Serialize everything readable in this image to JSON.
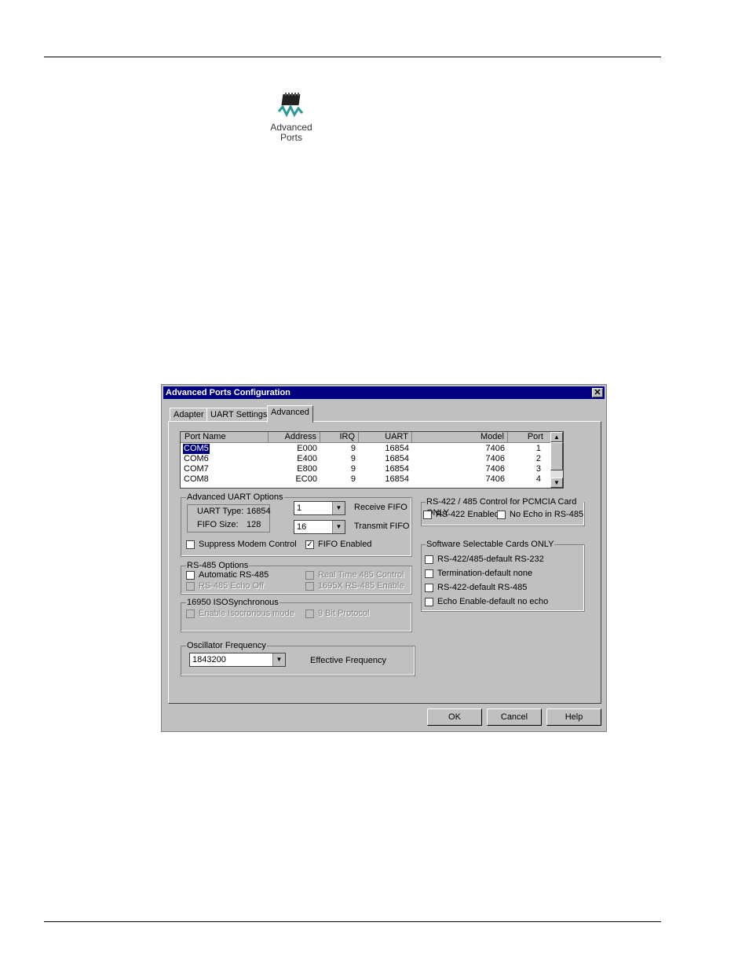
{
  "icon": {
    "name": "chip-icon",
    "label_line1": "Advanced",
    "label_line2": "Ports"
  },
  "dialog": {
    "title": "Advanced Ports Configuration",
    "close": "✕",
    "tabs": [
      "Adapter",
      "UART Settings",
      "Advanced"
    ],
    "active_tab": "Advanced",
    "list": {
      "columns": [
        "Port Name",
        "Address",
        "IRQ",
        "UART",
        "Model",
        "Port"
      ],
      "rows": [
        [
          "COM5",
          "E000",
          "9",
          "16854",
          "7406",
          "1"
        ],
        [
          "COM6",
          "E400",
          "9",
          "16854",
          "7406",
          "2"
        ],
        [
          "COM7",
          "E800",
          "9",
          "16854",
          "7406",
          "3"
        ],
        [
          "COM8",
          "EC00",
          "9",
          "16854",
          "7406",
          "4"
        ]
      ],
      "selected": "COM5"
    },
    "advanced_uart": {
      "title": "Advanced UART Options",
      "uart_type_label": "UART Type:",
      "uart_type_value": "16854",
      "fifo_size_label": "FIFO Size:",
      "fifo_size_value": "128",
      "receive_fifo_value": "1",
      "receive_fifo_label": "Receive FIFO",
      "transmit_fifo_value": "16",
      "transmit_fifo_label": "Transmit FIFO",
      "suppress_modem_label": "Suppress Modem Control",
      "fifo_enabled_label": "FIFO Enabled",
      "fifo_enabled_check": "✓"
    },
    "rs485": {
      "title": "RS-485 Options",
      "automatic_label": "Automatic RS-485",
      "echo_off_label": "RS-485 Echo Off",
      "real_time_label": "Real Time 485 Control",
      "enable_label": "1695X RS-485 Enable"
    },
    "isosync": {
      "title": "16950 ISOSynchronous",
      "enable_label": "Enable Isocronous mode",
      "nine_bit_label": "9 Bit Protocol"
    },
    "oscillator": {
      "title": "Oscillator Frequency",
      "value": "1843200",
      "effective_label": "Effective Frequency"
    },
    "pcmcia": {
      "title": "RS-422 / 485 Control for PCMCIA Card ONLY",
      "rs422_label": "RS-422 Enabled",
      "noecho_label": "No Echo in RS-485"
    },
    "software": {
      "title": "Software Selectable Cards ONLY",
      "items": [
        "RS-422/485-default RS-232",
        "Termination-default none",
        "RS-422-default RS-485",
        "Echo Enable-default no echo"
      ]
    },
    "buttons": {
      "ok": "OK",
      "cancel": "Cancel",
      "help": "Help"
    },
    "scroll": {
      "up": "▲",
      "down": "▼"
    },
    "arrow": "▼"
  }
}
